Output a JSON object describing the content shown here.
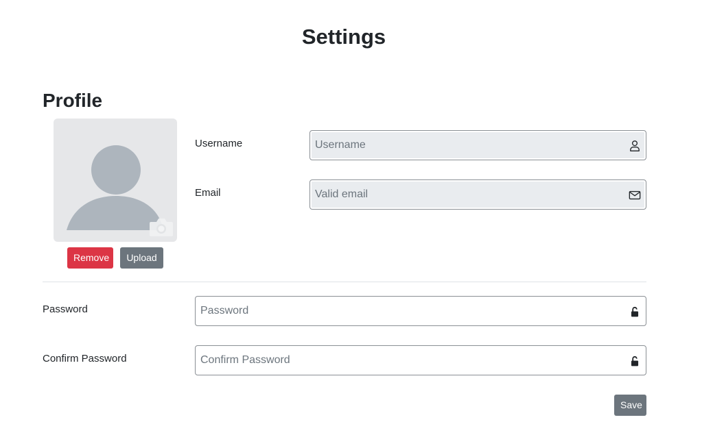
{
  "page": {
    "title": "Settings"
  },
  "profile": {
    "heading": "Profile",
    "avatar": {
      "placeholder_icon": "person-silhouette-icon",
      "overlay_icon": "camera-icon"
    },
    "remove_label": "Remove",
    "upload_label": "Upload",
    "username": {
      "label": "Username",
      "placeholder": "Username",
      "value": "",
      "icon": "person-icon"
    },
    "email": {
      "label": "Email",
      "placeholder": "Valid email",
      "value": "",
      "icon": "envelope-icon"
    }
  },
  "security": {
    "password": {
      "label": "Password",
      "placeholder": "Password",
      "value": "",
      "icon": "unlock-icon"
    },
    "confirm_password": {
      "label": "Confirm Password",
      "placeholder": "Confirm Password",
      "value": "",
      "icon": "unlock-icon"
    }
  },
  "actions": {
    "save_label": "Save"
  },
  "colors": {
    "danger": "#dc3545",
    "secondary": "#6c757d",
    "readonly_field": "#e9ecef",
    "avatar_bg": "#e6e7e9",
    "avatar_figure": "#adb5bd"
  }
}
